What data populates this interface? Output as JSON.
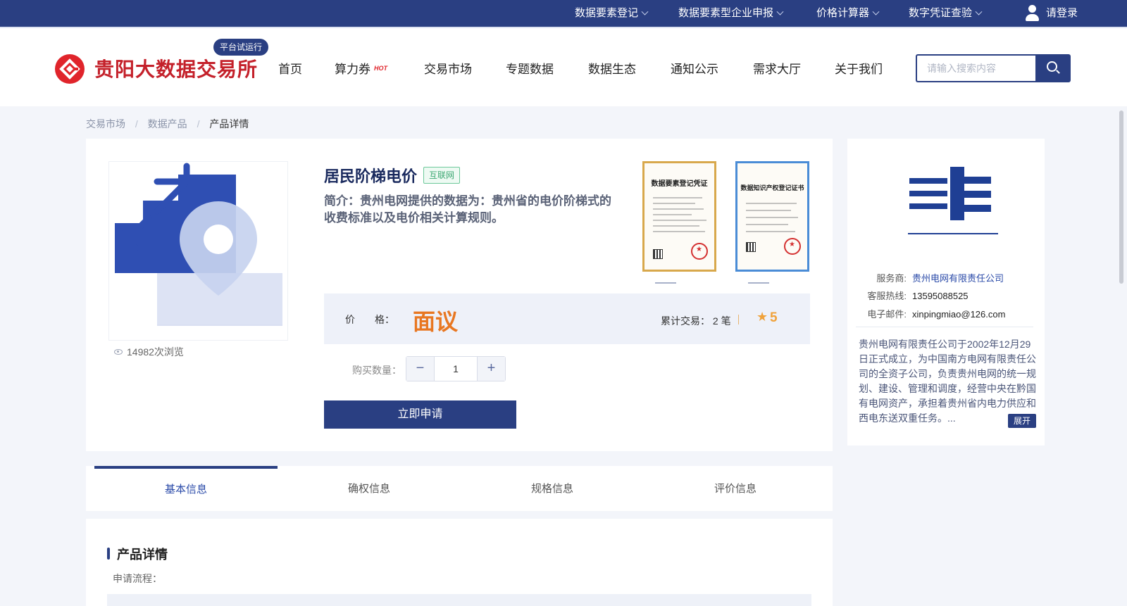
{
  "topbar": {
    "items": [
      {
        "label": "数据要素登记"
      },
      {
        "label": "数据要素型企业申报"
      },
      {
        "label": "价格计算器"
      },
      {
        "label": "数字凭证查验"
      }
    ],
    "login_label": "请登录"
  },
  "header": {
    "logo_text": "贵阳大数据交易所",
    "badge": "平台试运行",
    "nav": [
      {
        "label": "首页"
      },
      {
        "label": "算力券"
      },
      {
        "label": "交易市场"
      },
      {
        "label": "专题数据"
      },
      {
        "label": "数据生态"
      },
      {
        "label": "通知公示"
      },
      {
        "label": "需求大厅"
      },
      {
        "label": "关于我们"
      }
    ],
    "hot_tag": "HOT",
    "search_placeholder": "请输入搜索内容"
  },
  "breadcrumb": {
    "items": [
      "交易市场",
      "数据产品"
    ],
    "current": "产品详情",
    "separator": "/"
  },
  "product": {
    "title": "居民阶梯电价",
    "tag": "互联网",
    "description": "简介：贵州电网提供的数据为：贵州省的电价阶梯式的收费标准以及电价相关计算规则。",
    "views": "14982次浏览",
    "certificates": [
      {
        "title": "数据要素登记凭证"
      },
      {
        "title": "数据知识产权登记证书"
      }
    ],
    "price_label": "价　　格：",
    "price_value": "面议",
    "deals_text": "累计交易：  2 笔",
    "rating": "5",
    "qty_label": "购买数量：",
    "qty_value": "1",
    "qty_minus": "−",
    "qty_plus": "+",
    "apply_label": "立即申请"
  },
  "provider": {
    "fields": [
      {
        "label": "服务商:",
        "value": "贵州电网有限责任公司"
      },
      {
        "label": "客服热线:",
        "value": "13595088525"
      },
      {
        "label": "电子邮件:",
        "value": "xinpingmiao@126.com"
      }
    ],
    "description": "贵州电网有限责任公司于2002年12月29日正式成立，为中国南方电网有限责任公司的全资子公司，负责贵州电网的统一规划、建设、管理和调度，经营中央在黔国有电网资产，承担着贵州省内电力供应和西电东送双重任务。...",
    "expand_label": "展开"
  },
  "tabs": [
    {
      "label": "基本信息",
      "active": true
    },
    {
      "label": "确权信息",
      "active": false
    },
    {
      "label": "规格信息",
      "active": false
    },
    {
      "label": "评价信息",
      "active": false
    }
  ],
  "details": {
    "title": "产品详情",
    "subtitle": "申请流程："
  },
  "colors": {
    "brand_navy": "#2a3f82",
    "logo_red": "#c4202a",
    "price_orange": "#e87722",
    "rating_gold": "#f0a23b"
  }
}
